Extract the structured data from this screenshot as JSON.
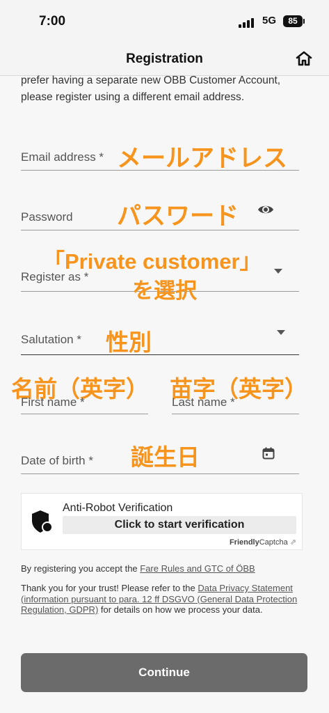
{
  "status": {
    "time": "7:00",
    "network": "5G",
    "battery": "85"
  },
  "header": {
    "title": "Registration",
    "home_icon": "home-icon"
  },
  "intro_text": "prefer having a separate new OBB Customer Account, please register using a different email address.",
  "form": {
    "email": {
      "label": "Email address *",
      "annotation": "メールアドレス"
    },
    "password": {
      "label": "Password",
      "annotation": "パスワード",
      "icon": "eye-icon"
    },
    "register_as": {
      "label": "Register as *",
      "annotation_line1": "「Private customer」",
      "annotation_line2": "を選択"
    },
    "salutation": {
      "label": "Salutation *",
      "annotation": "性別"
    },
    "first_name": {
      "label": "First name *",
      "annotation": "名前（英字）"
    },
    "last_name": {
      "label": "Last name *",
      "annotation": "苗字（英字）"
    },
    "date_of_birth": {
      "label": "Date of birth *",
      "annotation": "誕生日",
      "icon": "calendar-icon"
    }
  },
  "captcha": {
    "title": "Anti-Robot Verification",
    "button_label": "Click to start verification",
    "brand_bold": "Friendly",
    "brand_rest": "Captcha",
    "brand_arrow": "⇗"
  },
  "legal": {
    "accept_prefix": "By registering you accept the ",
    "accept_link": "Fare Rules and GTC of ÖBB",
    "thanks_prefix": "Thank you for your trust! Please refer to the ",
    "privacy_link": "Data Privacy Statement (information pursuant to para. 12 ff DSGVO (General Data Protection Regulation, GDPR)",
    "thanks_suffix": " for details on how we process your data."
  },
  "continue_label": "Continue",
  "colors": {
    "annotation": "#f7941d",
    "button": "#6b6b6b",
    "background": "#f7f7f7"
  }
}
